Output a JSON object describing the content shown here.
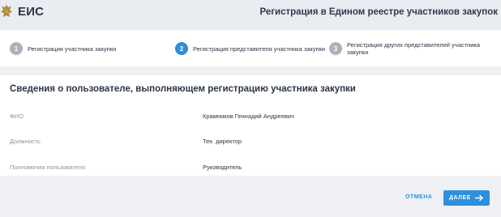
{
  "header": {
    "logo_text": "ЕИС",
    "title": "Регистрация в Едином реестре участников закупок"
  },
  "steps": [
    {
      "number": "1",
      "label": "Регистрация участника закупки",
      "state": "inactive"
    },
    {
      "number": "2",
      "label": "Регистрация представителя участника закупки",
      "state": "active"
    },
    {
      "number": "3",
      "label": "Регистрация других представителей участника закупки",
      "state": "inactive"
    }
  ],
  "section": {
    "title": "Сведения о пользователе, выполняющем регистрацию участника закупки",
    "rows": [
      {
        "label": "ФИО",
        "value": "Крамников Геннадий Андреевич"
      },
      {
        "label": "Должность",
        "value": "Тех. директор"
      },
      {
        "label": "Полномочия пользователя",
        "value": "Руководитель"
      }
    ]
  },
  "actions": {
    "cancel_label": "ОТМЕНА",
    "next_label": "ДАЛЕЕ",
    "next_icon": "arrow-right-icon"
  },
  "colors": {
    "accent": "#2d8fdd",
    "inactive_step": "#aab2be",
    "page_background": "#eef0f3"
  }
}
